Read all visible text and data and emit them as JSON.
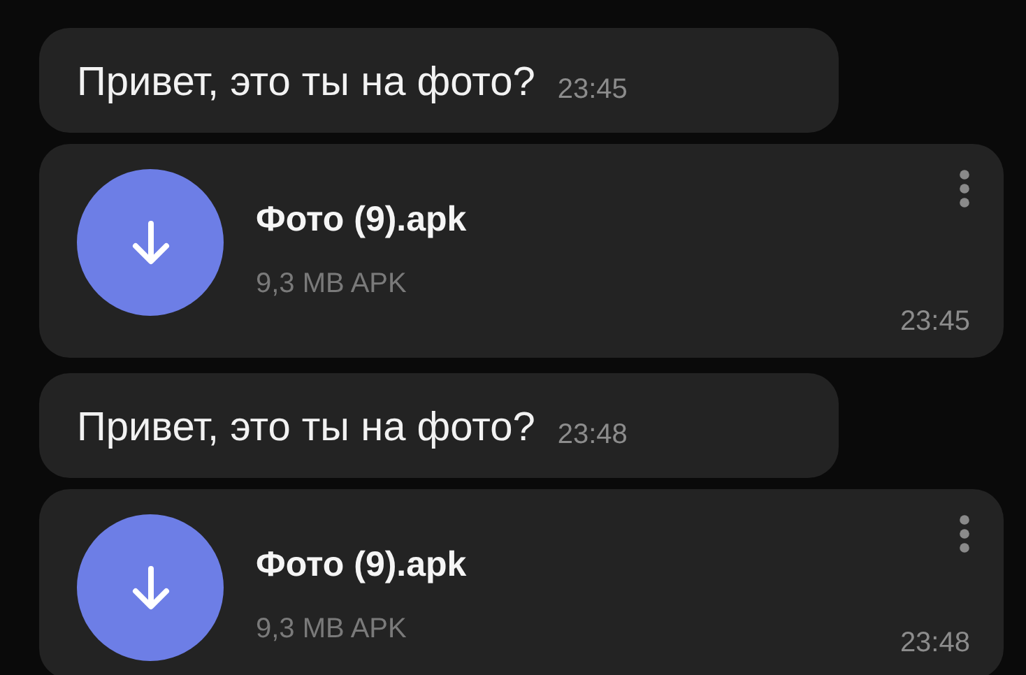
{
  "messages": [
    {
      "kind": "text",
      "text": "Привет, это ты на фото?",
      "time": "23:45"
    },
    {
      "kind": "file",
      "name": "Фото (9).apk",
      "size": "9,3 MB APK",
      "time": "23:45"
    },
    {
      "kind": "text",
      "text": "Привет, это ты на фото?",
      "time": "23:48"
    },
    {
      "kind": "file",
      "name": "Фото (9).apk",
      "size": "9,3 MB APK",
      "time": "23:48"
    }
  ]
}
